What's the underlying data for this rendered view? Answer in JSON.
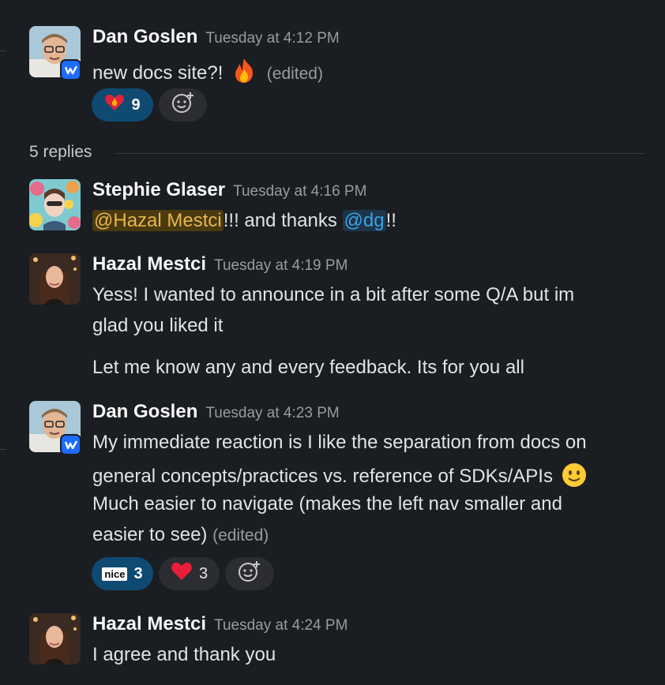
{
  "thread": {
    "root": {
      "author": "Dan Goslen",
      "time": "Tuesday at 4:12 PM",
      "text": "new docs site?!",
      "edited": "(edited)",
      "reactions": [
        {
          "emoji": "heart-on-fire",
          "count": "9",
          "active": true
        }
      ]
    },
    "replies_label": "5 replies",
    "replies": [
      {
        "author": "Stephie Glaser",
        "time": "Tuesday at 4:16 PM",
        "mention1": "@Hazal Mestci",
        "text_mid": "!!! and thanks ",
        "mention2": "@dg",
        "text_end": "!!"
      },
      {
        "author": "Hazal Mestci",
        "time": "Tuesday at 4:19 PM",
        "line1": "Yess! I wanted to announce in a bit after some Q/A but im",
        "line2": "glad you liked it",
        "line3": "Let me know any and every feedback. Its for you all"
      },
      {
        "author": "Dan Goslen",
        "time": "Tuesday at 4:23 PM",
        "line1": "My immediate reaction is I like the separation from docs on",
        "line2": "general concepts/practices vs. reference of SDKs/APIs",
        "line3": "Much easier to navigate (makes the left nav smaller and",
        "line4": "easier to see)",
        "edited": "(edited)",
        "reactions": [
          {
            "emoji": "nice",
            "label": "nice",
            "count": "3",
            "active": true
          },
          {
            "emoji": "red-heart",
            "count": "3",
            "active": false
          }
        ]
      },
      {
        "author": "Hazal Mestci",
        "time": "Tuesday at 4:24 PM",
        "text": "I agree and thank you"
      }
    ]
  },
  "colors": {
    "background": "#1a1d21",
    "accent_active_reaction": "#0f4a73",
    "mention_highlight": "#e8b54a",
    "mention_link": "#3aa3e3",
    "badge": "#1d6bff"
  }
}
